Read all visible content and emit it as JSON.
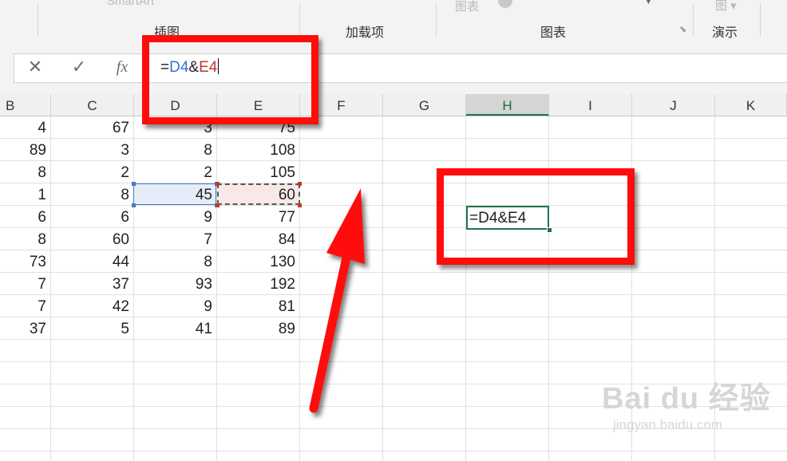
{
  "ribbon": {
    "groups": [
      {
        "label": "插图",
        "faint": "SmartArt"
      },
      {
        "label": "加载项"
      },
      {
        "label": "图表",
        "faint": "图表"
      },
      {
        "label": "演示",
        "faint": "图 ▾"
      }
    ]
  },
  "formula_bar": {
    "cancel_icon": "✕",
    "enter_icon": "✓",
    "fx_label": "fx",
    "formula_prefix": "=",
    "ref1": "D4",
    "amp": "&",
    "ref2": "E4"
  },
  "columns": [
    "B",
    "C",
    "D",
    "E",
    "F",
    "G",
    "H",
    "I",
    "J",
    "K"
  ],
  "selected_column": "H",
  "rows": [
    [
      "4",
      "67",
      "3",
      "75"
    ],
    [
      "89",
      "3",
      "8",
      "108"
    ],
    [
      "8",
      "2",
      "2",
      "105"
    ],
    [
      "1",
      "8",
      "45",
      "60"
    ],
    [
      "6",
      "6",
      "9",
      "77"
    ],
    [
      "8",
      "60",
      "7",
      "84"
    ],
    [
      "73",
      "44",
      "8",
      "130"
    ],
    [
      "7",
      "37",
      "93",
      "192"
    ],
    [
      "7",
      "42",
      "9",
      "81"
    ],
    [
      "37",
      "5",
      "41",
      "89"
    ]
  ],
  "active_cell": {
    "column": "H",
    "text": "=D4&E4"
  },
  "watermark": {
    "line1": "Bai du 经验",
    "line2": "jingyan.baidu.com"
  },
  "colors": {
    "accent": "#217346",
    "annotation": "#ff0d0d",
    "ref_blue": "#3a6fd0",
    "ref_red": "#c0392b"
  }
}
